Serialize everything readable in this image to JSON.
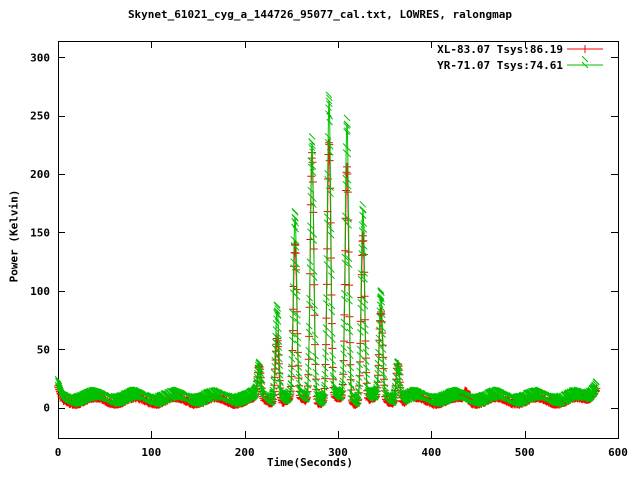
{
  "title": "Skynet_61021_cyg_a_144726_95077_cal.txt, LOWRES, ralongmap",
  "legend": [
    {
      "label": "XL-83.07 Tsys:86.19",
      "color": "#ff0000",
      "marker": "plus"
    },
    {
      "label": "YR-71.07 Tsys:74.61",
      "color": "#00c000",
      "marker": "cross"
    }
  ],
  "chart_data": {
    "type": "line",
    "style": "linespoints",
    "title": "Skynet_61021_cyg_a_144726_95077_cal.txt, LOWRES, ralongmap",
    "xlabel": "Time(Seconds)",
    "ylabel": "Power (Kelvin)",
    "axes": {
      "x_range": [
        0,
        600
      ],
      "y_range": [
        -26,
        314
      ],
      "x_ticks": [
        0,
        100,
        200,
        300,
        400,
        500,
        600
      ],
      "y_ticks": [
        0,
        50,
        100,
        150,
        200,
        250,
        300
      ],
      "grid": false,
      "tick_style": "mirrored-inward",
      "legend_position": "top-right-inside"
    },
    "series": [
      {
        "name": "XL-83.07 Tsys:86.19",
        "color": "#ff0000",
        "marker": "plus",
        "peak_heights_kelvin": [
          34,
          62,
          138,
          220,
          226,
          207,
          148,
          80,
          41
        ]
      },
      {
        "name": "YR-71.07 Tsys:74.61",
        "color": "#00c000",
        "marker": "cross",
        "peak_heights_kelvin": [
          30,
          85,
          160,
          229,
          262,
          243,
          170,
          93,
          37
        ]
      }
    ],
    "peak_centers_s": [
      215.5,
      234.8,
      254.0,
      272.2,
      290.4,
      309.6,
      326.7,
      346.0,
      364.2
    ],
    "peak_sigma_s": 1.9,
    "baseline": {
      "mean": 5.8,
      "ripple_amplitude": 2.8,
      "ripple_period_s": 43,
      "ripple_crest_s": 40,
      "noise": 0.9,
      "green_offset": 0.8
    },
    "time_range_s": [
      0,
      577
    ],
    "sample_interval_s": 0.45,
    "extras": {
      "start_spike": {
        "t": 0,
        "value": 16
      },
      "end_rise": {
        "t_start": 562,
        "value_end": 19
      },
      "red_bumps": [
        {
          "t": 378,
          "value": 12
        },
        {
          "t": 437,
          "value": 14
        }
      ]
    }
  }
}
